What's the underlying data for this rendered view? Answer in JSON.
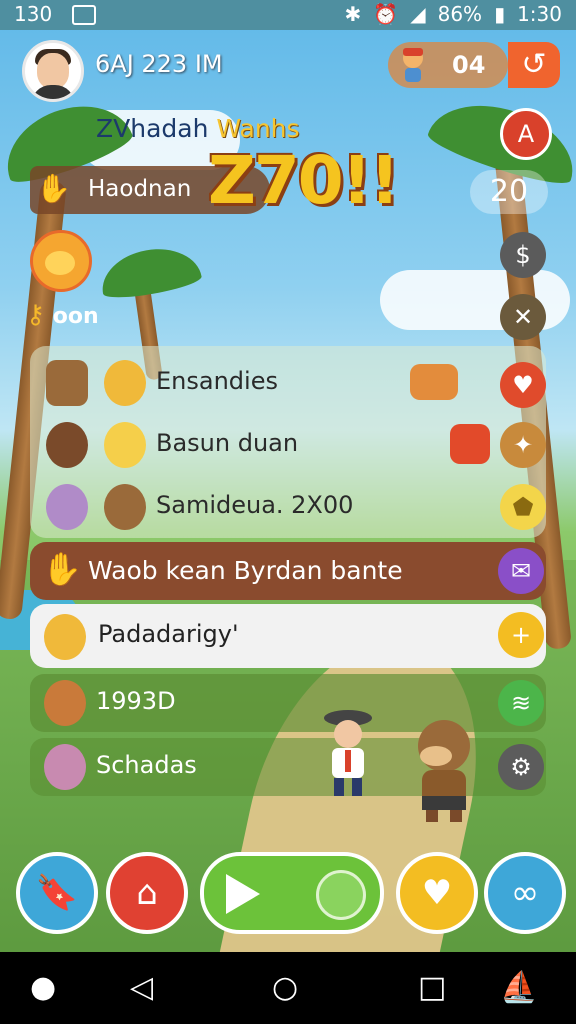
{
  "status_bar": {
    "time_left": "130",
    "battery": "86%",
    "clock": "1:30"
  },
  "header": {
    "player_id": "6AJ 223 IM",
    "coins": "04"
  },
  "title": {
    "subtitle_left": "ZVhadah",
    "subtitle_right": "Wanhs",
    "headline": "Haodnan",
    "big": "Z70!!",
    "score": "20"
  },
  "stats": {
    "key_value": "oon"
  },
  "list": {
    "items": [
      {
        "label": "Ensandies"
      },
      {
        "label": "Basun duan"
      },
      {
        "label": "Samideua. 2X00"
      }
    ]
  },
  "banner": {
    "text": "Waob kean Byrdan bante"
  },
  "menu": {
    "highlight": "Padadarigy'",
    "row1": "1993D",
    "row2": "Schadas"
  },
  "colors": {
    "accent": "#f0642e",
    "banner": "#8a4b2e",
    "play": "#6cc23a",
    "gold": "#f5c41f"
  }
}
